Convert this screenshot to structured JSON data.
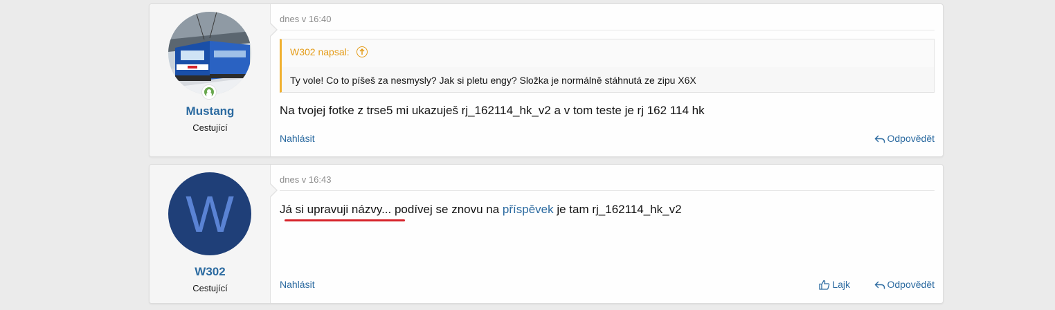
{
  "posts": [
    {
      "user": {
        "name": "Mustang",
        "title": "Cestující",
        "avatar_type": "photo-train",
        "status": "online"
      },
      "date": "dnes v 16:40",
      "quote": {
        "author": "W302 napsal:",
        "text": "Ty vole! Co to píšeš za nesmysly? Jak si pletu engy? Složka je normálně stáhnutá ze zipu X6X"
      },
      "message": "Na tvojej fotke z trse5 mi ukazuješ rj_162114_hk_v2 a v tom teste je rj 162 114 hk",
      "actions": {
        "report": "Nahlásit",
        "reply": "Odpovědět"
      }
    },
    {
      "user": {
        "name": "W302",
        "title": "Cestující",
        "avatar_letter": "W",
        "avatar_color": "#1f3f78"
      },
      "date": "dnes v 16:43",
      "message_parts": {
        "before": "Já si upravuji názvy... podívej se znovu na ",
        "link": "příspěvek",
        "after": " je tam rj_162114_hk_v2"
      },
      "actions": {
        "report": "Nahlásit",
        "like": "Lajk",
        "reply": "Odpovědět"
      }
    }
  ],
  "colors": {
    "link": "#2b6aa0",
    "quote_accent": "#e49b16",
    "annotation_underline": "#d6232a"
  }
}
